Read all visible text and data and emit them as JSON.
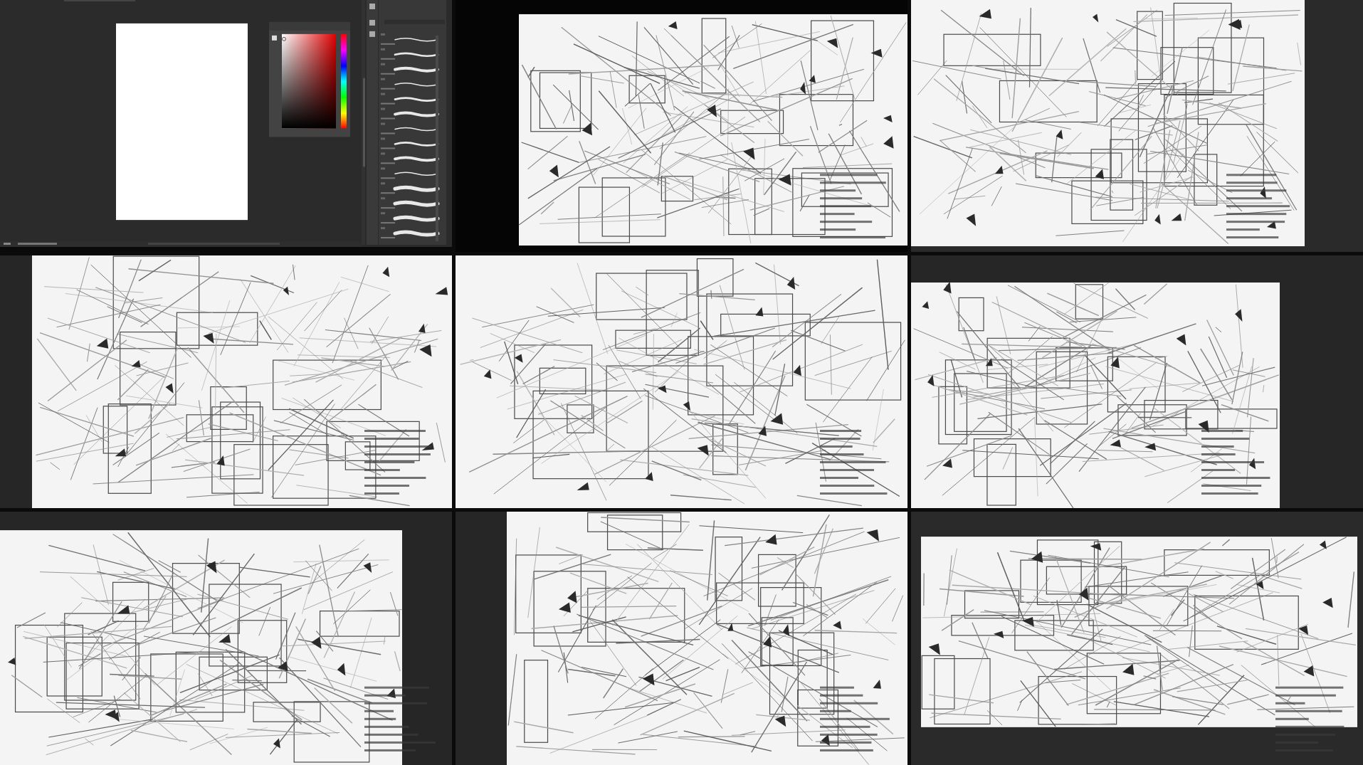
{
  "frames": [
    {
      "kind": "editor"
    },
    {
      "kind": "sketch"
    },
    {
      "kind": "sketch"
    },
    {
      "kind": "sketch"
    },
    {
      "kind": "sketch"
    },
    {
      "kind": "sketch"
    },
    {
      "kind": "sketch"
    },
    {
      "kind": "sketch"
    },
    {
      "kind": "sketch"
    }
  ]
}
